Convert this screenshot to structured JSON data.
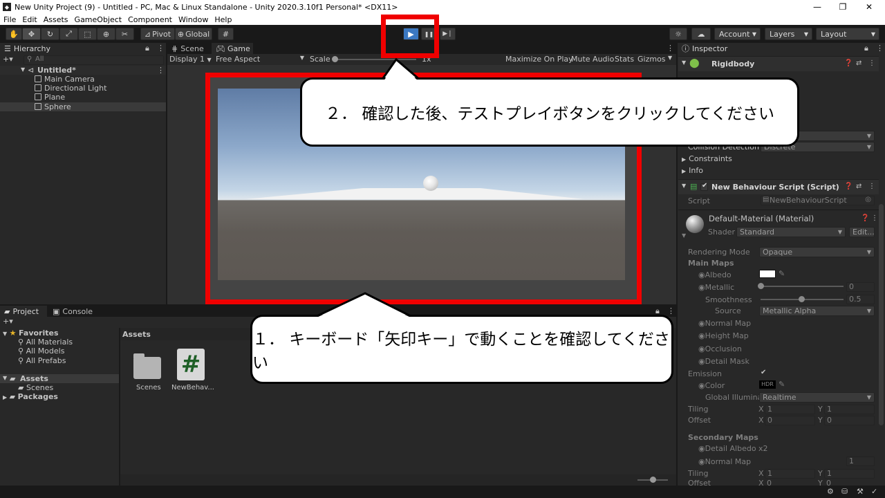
{
  "window": {
    "title": "New Unity Project (9) - Untitled - PC, Mac & Linux Standalone - Unity 2020.3.10f1 Personal* <DX11>",
    "minimize": "—",
    "maximize": "❐",
    "close": "✕"
  },
  "menu": [
    "File",
    "Edit",
    "Assets",
    "GameObject",
    "Component",
    "Window",
    "Help"
  ],
  "toolbar": {
    "pivot": "Pivot",
    "global": "Global",
    "account": "Account",
    "layers": "Layers",
    "layout": "Layout",
    "play_icon": "▶",
    "pause_icon": "❚❚",
    "step_icon": "▶❘"
  },
  "hierarchy": {
    "tab": "Hierarchy",
    "search_placeholder": "All",
    "add": "+▾",
    "scene": "Untitled*",
    "items": [
      "Main Camera",
      "Directional Light",
      "Plane",
      "Sphere"
    ]
  },
  "scene_tabs": {
    "scene": "Scene",
    "game": "Game",
    "display": "Display 1",
    "aspect": "Free Aspect",
    "scale_label": "Scale",
    "scale_value": "1x",
    "maximize": "Maximize On Play",
    "mute": "Mute Audio",
    "stats": "Stats",
    "gizmos": "Gizmos"
  },
  "project": {
    "tab_project": "Project",
    "tab_console": "Console",
    "add": "+▾",
    "favorites": "Favorites",
    "favorites_items": [
      "All Materials",
      "All Models",
      "All Prefabs"
    ],
    "assets": "Assets",
    "assets_children": [
      "Scenes"
    ],
    "packages": "Packages",
    "breadcrumb": "Assets",
    "files": [
      {
        "name": "Scenes"
      },
      {
        "name": "NewBehav..."
      }
    ],
    "script_glyph": "#"
  },
  "inspector": {
    "tab": "Inspector",
    "rigidbody": "Rigidbody",
    "collision_detection": "Collision Detection",
    "collision_value": "Discrete",
    "constraints": "Constraints",
    "info": "Info",
    "script_component": "New Behaviour Script (Script)",
    "script_label": "Script",
    "script_value": "NewBehaviourScript",
    "material": "Default-Material (Material)",
    "shader_label": "Shader",
    "shader_value": "Standard",
    "edit": "Edit...",
    "rendering_mode_label": "Rendering Mode",
    "rendering_mode_value": "Opaque",
    "main_maps": "Main Maps",
    "albedo": "Albedo",
    "metallic": "Metallic",
    "metallic_value": "0",
    "smoothness": "Smoothness",
    "smoothness_value": "0.5",
    "source": "Source",
    "source_value": "Metallic Alpha",
    "normal_map": "Normal Map",
    "height_map": "Height Map",
    "occlusion": "Occlusion",
    "detail_mask": "Detail Mask",
    "emission": "Emission",
    "color": "Color",
    "hdr": "HDR",
    "global_illum": "Global Illuminati",
    "global_illum_value": "Realtime",
    "tiling": "Tiling",
    "offset": "Offset",
    "x_label": "X",
    "y_label": "Y",
    "tiling_x": "1",
    "tiling_y": "1",
    "offset_x": "0",
    "offset_y": "0",
    "secondary_maps": "Secondary Maps",
    "detail_albedo": "Detail Albedo x2",
    "normal_map2": "Normal Map",
    "normal_map2_value": "1",
    "tiling2": "Tiling",
    "tiling2_x": "1",
    "tiling2_y": "1",
    "offset2": "Offset",
    "offset2_x": "0",
    "offset2_y": "0"
  },
  "callouts": {
    "step2": "２． 確認した後、テストプレイボタンをクリックしてください",
    "step1": "１． キーボード「矢印キー」で動くことを確認してください"
  },
  "colors": {
    "highlight": "#f00000",
    "play_active": "#3b78c2"
  }
}
